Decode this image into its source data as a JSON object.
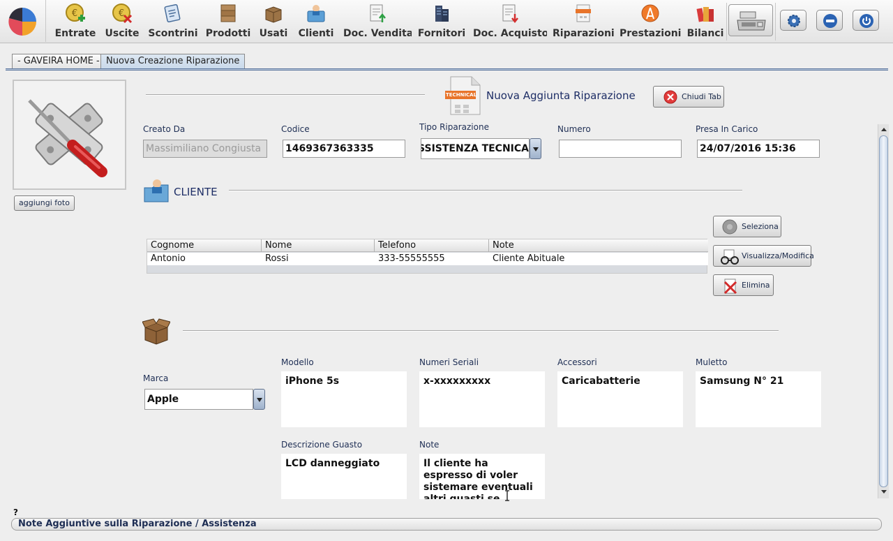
{
  "toolbar": {
    "items": [
      {
        "label": "Entrate",
        "icon": "coin-add-icon"
      },
      {
        "label": "Uscite",
        "icon": "coin-remove-icon"
      },
      {
        "label": "Scontrini",
        "icon": "receipt-icon"
      },
      {
        "label": "Prodotti",
        "icon": "boxes-icon"
      },
      {
        "label": "Usati",
        "icon": "open-box-icon"
      },
      {
        "label": "Clienti",
        "icon": "client-folder-icon"
      },
      {
        "label": "Doc. Vendita",
        "icon": "sale-document-icon"
      },
      {
        "label": "Fornitori",
        "icon": "supplier-building-icon"
      },
      {
        "label": "Doc. Acquisto",
        "icon": "purchase-document-icon"
      },
      {
        "label": "Riparazioni",
        "icon": "technical-document-icon"
      },
      {
        "label": "Prestazioni",
        "icon": "compass-icon"
      },
      {
        "label": "Bilanci",
        "icon": "books-icon"
      }
    ]
  },
  "tabs": [
    {
      "label": "- GAVEIRA HOME -"
    },
    {
      "label": "Nuova Creazione Riparazione"
    }
  ],
  "photo": {
    "add_button": "aggiungi foto"
  },
  "header": {
    "title": "Nuova Aggiunta Riparazione",
    "close_button": "Chiudi Tab",
    "badge_text": "TECHNICAL"
  },
  "fields": {
    "creato_da": {
      "label": "Creato Da",
      "value": "Massimiliano Congiusta"
    },
    "codice": {
      "label": "Codice",
      "value": "1469367363335"
    },
    "tipo": {
      "label": "Tipo Riparazione",
      "value": "ASSISTENZA TECNICA"
    },
    "numero": {
      "label": "Numero",
      "value": ""
    },
    "presa": {
      "label": "Presa In Carico",
      "value": "24/07/2016 15:36"
    }
  },
  "cliente": {
    "title": "CLIENTE",
    "columns": [
      "Cognome",
      "Nome",
      "Telefono",
      "Note"
    ],
    "rows": [
      [
        "Antonio",
        "Rossi",
        "333-55555555",
        "Cliente Abituale"
      ]
    ],
    "buttons": {
      "seleziona": "Seleziona",
      "visualizza": "Visualizza/Modifica",
      "elimina": "Elimina"
    }
  },
  "device": {
    "marca": {
      "label": "Marca",
      "value": "Apple"
    },
    "modello": {
      "label": "Modello",
      "value": "iPhone 5s"
    },
    "seriali": {
      "label": "Numeri Seriali",
      "value": "x-xxxxxxxxx"
    },
    "accessori": {
      "label": "Accessori",
      "value": "Caricabatterie"
    },
    "muletto": {
      "label": "Muletto",
      "value": "Samsung N° 21"
    },
    "guasto": {
      "label": "Descrizione Guasto",
      "value": "LCD danneggiato"
    },
    "note": {
      "label": "Note",
      "value": "Il cliente ha espresso di voler sistemare eventuali altri guasti se presenti"
    }
  },
  "footer": {
    "question_mark": "?",
    "bottom_bar": "Note Aggiuntive sulla Riparazione / Assistenza"
  }
}
